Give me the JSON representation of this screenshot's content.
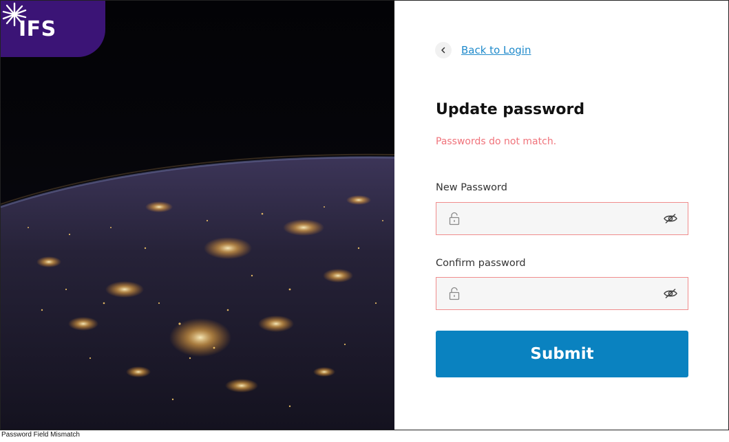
{
  "brand": {
    "logo_text": "IFS",
    "logo_color": "#3b1476"
  },
  "back": {
    "label": "Back to Login",
    "icon": "chevron-left-icon"
  },
  "form": {
    "title": "Update password",
    "error": "Passwords do not match.",
    "new_password": {
      "label": "New Password",
      "value": "",
      "lock_icon": "lock-open-icon",
      "toggle_icon": "eye-off-icon"
    },
    "confirm_password": {
      "label": "Confirm password",
      "value": "",
      "lock_icon": "lock-open-icon",
      "toggle_icon": "eye-off-icon"
    },
    "submit_label": "Submit"
  },
  "colors": {
    "accent": "#0a82c0",
    "error": "#f0737b",
    "link": "#1f8acb",
    "field_border_error": "#f08c8c"
  },
  "caption": "Password Field Mismatch"
}
